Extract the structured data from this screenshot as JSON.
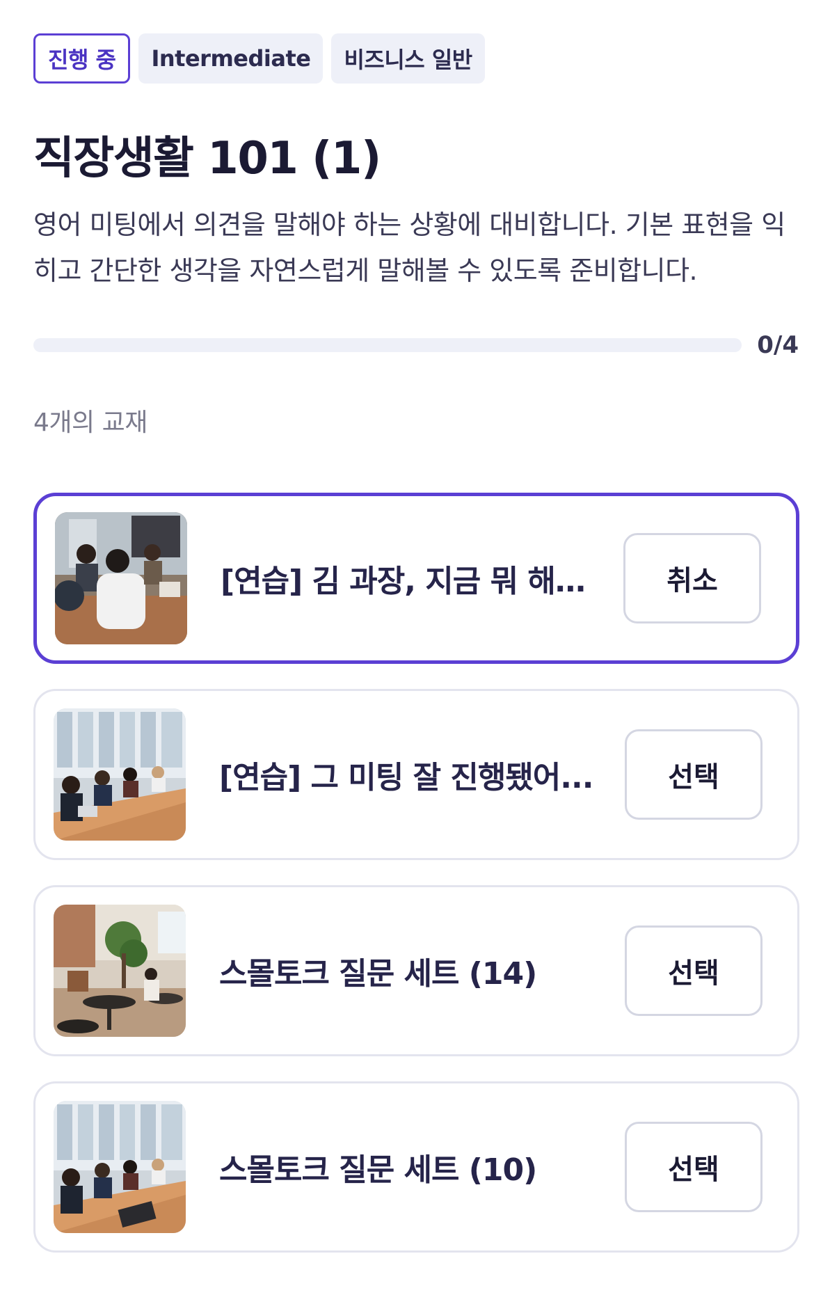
{
  "tags": {
    "status": "진행 중",
    "level": "Intermediate",
    "category": "비즈니스 일반"
  },
  "course": {
    "title": "직장생활 101 (1)",
    "description": "영어 미팅에서 의견을 말해야 하는 상황에 대비합니다. 기본 표현을 익히고 간단한 생각을 자연스럽게 말해볼 수 있도록 준비합니다."
  },
  "progress": {
    "text": "0/4",
    "fraction": 0
  },
  "materials": {
    "count_label": "4개의 교재",
    "items": [
      {
        "title": "[연습] 김 과장, 지금 뭐 해요?",
        "button": "취소",
        "selected": true,
        "thumb": "meeting-photo"
      },
      {
        "title": "[연습] 그 미팅 잘 진행됐어...",
        "button": "선택",
        "selected": false,
        "thumb": "conference-table-photo"
      },
      {
        "title": "스몰토크 질문 세트 (14)",
        "button": "선택",
        "selected": false,
        "thumb": "office-lounge-photo"
      },
      {
        "title": "스몰토크 질문 세트 (10)",
        "button": "선택",
        "selected": false,
        "thumb": "conference-table-photo"
      }
    ]
  },
  "colors": {
    "accent": "#5b3fd4",
    "tag_bg": "#eef0f8",
    "card_border": "#e3e4ee"
  }
}
